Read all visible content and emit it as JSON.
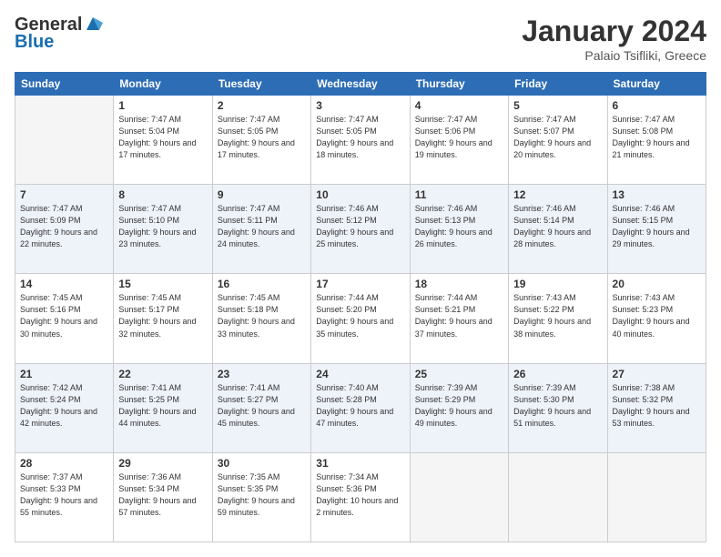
{
  "logo": {
    "general": "General",
    "blue": "Blue"
  },
  "title": "January 2024",
  "subtitle": "Palaio Tsifliki, Greece",
  "header_days": [
    "Sunday",
    "Monday",
    "Tuesday",
    "Wednesday",
    "Thursday",
    "Friday",
    "Saturday"
  ],
  "weeks": [
    [
      {
        "day": "",
        "sunrise": "",
        "sunset": "",
        "daylight": ""
      },
      {
        "day": "1",
        "sunrise": "Sunrise: 7:47 AM",
        "sunset": "Sunset: 5:04 PM",
        "daylight": "Daylight: 9 hours and 17 minutes."
      },
      {
        "day": "2",
        "sunrise": "Sunrise: 7:47 AM",
        "sunset": "Sunset: 5:05 PM",
        "daylight": "Daylight: 9 hours and 17 minutes."
      },
      {
        "day": "3",
        "sunrise": "Sunrise: 7:47 AM",
        "sunset": "Sunset: 5:05 PM",
        "daylight": "Daylight: 9 hours and 18 minutes."
      },
      {
        "day": "4",
        "sunrise": "Sunrise: 7:47 AM",
        "sunset": "Sunset: 5:06 PM",
        "daylight": "Daylight: 9 hours and 19 minutes."
      },
      {
        "day": "5",
        "sunrise": "Sunrise: 7:47 AM",
        "sunset": "Sunset: 5:07 PM",
        "daylight": "Daylight: 9 hours and 20 minutes."
      },
      {
        "day": "6",
        "sunrise": "Sunrise: 7:47 AM",
        "sunset": "Sunset: 5:08 PM",
        "daylight": "Daylight: 9 hours and 21 minutes."
      }
    ],
    [
      {
        "day": "7",
        "sunrise": "Sunrise: 7:47 AM",
        "sunset": "Sunset: 5:09 PM",
        "daylight": "Daylight: 9 hours and 22 minutes."
      },
      {
        "day": "8",
        "sunrise": "Sunrise: 7:47 AM",
        "sunset": "Sunset: 5:10 PM",
        "daylight": "Daylight: 9 hours and 23 minutes."
      },
      {
        "day": "9",
        "sunrise": "Sunrise: 7:47 AM",
        "sunset": "Sunset: 5:11 PM",
        "daylight": "Daylight: 9 hours and 24 minutes."
      },
      {
        "day": "10",
        "sunrise": "Sunrise: 7:46 AM",
        "sunset": "Sunset: 5:12 PM",
        "daylight": "Daylight: 9 hours and 25 minutes."
      },
      {
        "day": "11",
        "sunrise": "Sunrise: 7:46 AM",
        "sunset": "Sunset: 5:13 PM",
        "daylight": "Daylight: 9 hours and 26 minutes."
      },
      {
        "day": "12",
        "sunrise": "Sunrise: 7:46 AM",
        "sunset": "Sunset: 5:14 PM",
        "daylight": "Daylight: 9 hours and 28 minutes."
      },
      {
        "day": "13",
        "sunrise": "Sunrise: 7:46 AM",
        "sunset": "Sunset: 5:15 PM",
        "daylight": "Daylight: 9 hours and 29 minutes."
      }
    ],
    [
      {
        "day": "14",
        "sunrise": "Sunrise: 7:45 AM",
        "sunset": "Sunset: 5:16 PM",
        "daylight": "Daylight: 9 hours and 30 minutes."
      },
      {
        "day": "15",
        "sunrise": "Sunrise: 7:45 AM",
        "sunset": "Sunset: 5:17 PM",
        "daylight": "Daylight: 9 hours and 32 minutes."
      },
      {
        "day": "16",
        "sunrise": "Sunrise: 7:45 AM",
        "sunset": "Sunset: 5:18 PM",
        "daylight": "Daylight: 9 hours and 33 minutes."
      },
      {
        "day": "17",
        "sunrise": "Sunrise: 7:44 AM",
        "sunset": "Sunset: 5:20 PM",
        "daylight": "Daylight: 9 hours and 35 minutes."
      },
      {
        "day": "18",
        "sunrise": "Sunrise: 7:44 AM",
        "sunset": "Sunset: 5:21 PM",
        "daylight": "Daylight: 9 hours and 37 minutes."
      },
      {
        "day": "19",
        "sunrise": "Sunrise: 7:43 AM",
        "sunset": "Sunset: 5:22 PM",
        "daylight": "Daylight: 9 hours and 38 minutes."
      },
      {
        "day": "20",
        "sunrise": "Sunrise: 7:43 AM",
        "sunset": "Sunset: 5:23 PM",
        "daylight": "Daylight: 9 hours and 40 minutes."
      }
    ],
    [
      {
        "day": "21",
        "sunrise": "Sunrise: 7:42 AM",
        "sunset": "Sunset: 5:24 PM",
        "daylight": "Daylight: 9 hours and 42 minutes."
      },
      {
        "day": "22",
        "sunrise": "Sunrise: 7:41 AM",
        "sunset": "Sunset: 5:25 PM",
        "daylight": "Daylight: 9 hours and 44 minutes."
      },
      {
        "day": "23",
        "sunrise": "Sunrise: 7:41 AM",
        "sunset": "Sunset: 5:27 PM",
        "daylight": "Daylight: 9 hours and 45 minutes."
      },
      {
        "day": "24",
        "sunrise": "Sunrise: 7:40 AM",
        "sunset": "Sunset: 5:28 PM",
        "daylight": "Daylight: 9 hours and 47 minutes."
      },
      {
        "day": "25",
        "sunrise": "Sunrise: 7:39 AM",
        "sunset": "Sunset: 5:29 PM",
        "daylight": "Daylight: 9 hours and 49 minutes."
      },
      {
        "day": "26",
        "sunrise": "Sunrise: 7:39 AM",
        "sunset": "Sunset: 5:30 PM",
        "daylight": "Daylight: 9 hours and 51 minutes."
      },
      {
        "day": "27",
        "sunrise": "Sunrise: 7:38 AM",
        "sunset": "Sunset: 5:32 PM",
        "daylight": "Daylight: 9 hours and 53 minutes."
      }
    ],
    [
      {
        "day": "28",
        "sunrise": "Sunrise: 7:37 AM",
        "sunset": "Sunset: 5:33 PM",
        "daylight": "Daylight: 9 hours and 55 minutes."
      },
      {
        "day": "29",
        "sunrise": "Sunrise: 7:36 AM",
        "sunset": "Sunset: 5:34 PM",
        "daylight": "Daylight: 9 hours and 57 minutes."
      },
      {
        "day": "30",
        "sunrise": "Sunrise: 7:35 AM",
        "sunset": "Sunset: 5:35 PM",
        "daylight": "Daylight: 9 hours and 59 minutes."
      },
      {
        "day": "31",
        "sunrise": "Sunrise: 7:34 AM",
        "sunset": "Sunset: 5:36 PM",
        "daylight": "Daylight: 10 hours and 2 minutes."
      },
      {
        "day": "",
        "sunrise": "",
        "sunset": "",
        "daylight": ""
      },
      {
        "day": "",
        "sunrise": "",
        "sunset": "",
        "daylight": ""
      },
      {
        "day": "",
        "sunrise": "",
        "sunset": "",
        "daylight": ""
      }
    ]
  ]
}
